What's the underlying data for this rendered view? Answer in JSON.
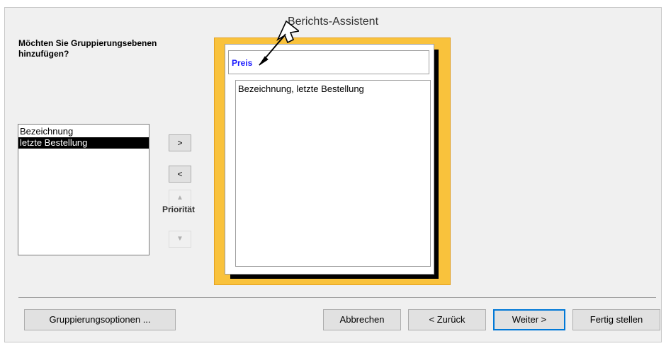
{
  "window": {
    "title": "Berichts-Assistent"
  },
  "prompt": {
    "question": "Möchten Sie Gruppierungsebenen hinzufügen?"
  },
  "fields": [
    {
      "label": "Bezeichnung",
      "selected": false
    },
    {
      "label": "letzte Bestellung",
      "selected": true
    }
  ],
  "move_buttons": {
    "add": ">",
    "remove": "<",
    "priority_label": "Priorität"
  },
  "preview": {
    "group_field": "Preis",
    "detail_fields": "Bezeichnung, letzte Bestellung",
    "background_color": "#f9c23c",
    "group_label_color": "#1a1aff"
  },
  "footer": {
    "grouping_options": "Gruppierungsoptionen ...",
    "cancel": "Abbrechen",
    "back": "< Zurück",
    "next": "Weiter >",
    "finish": "Fertig stellen"
  }
}
